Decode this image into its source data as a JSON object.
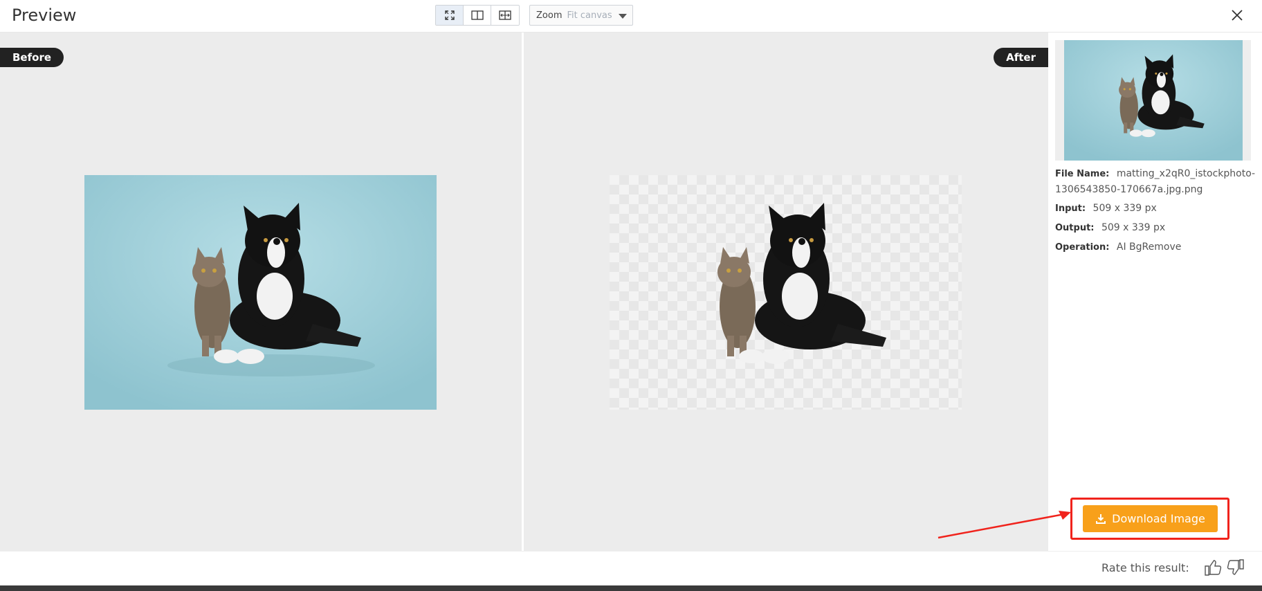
{
  "header": {
    "title": "Preview",
    "view_modes": [
      "fit-to-screen-icon",
      "split-view-icon",
      "compare-slider-icon"
    ],
    "zoom": {
      "label": "Zoom",
      "value": "Fit canvas"
    }
  },
  "stage": {
    "before_label": "Before",
    "after_label": "After",
    "colors": {
      "background": "#ececec",
      "photo_background": "#93c8d3"
    }
  },
  "panel": {
    "file_name_key": "File Name:",
    "file_name_value": "matting_x2qR0_istockphoto-1306543850-170667a.jpg.png",
    "input_key": "Input:",
    "input_value": "509 x 339 px",
    "output_key": "Output:",
    "output_value": "509 x 339 px",
    "operation_key": "Operation:",
    "operation_value": "AI BgRemove",
    "download_label": "Download Image",
    "accent_color": "#f8a01a"
  },
  "footer": {
    "rate_label": "Rate this result:"
  }
}
